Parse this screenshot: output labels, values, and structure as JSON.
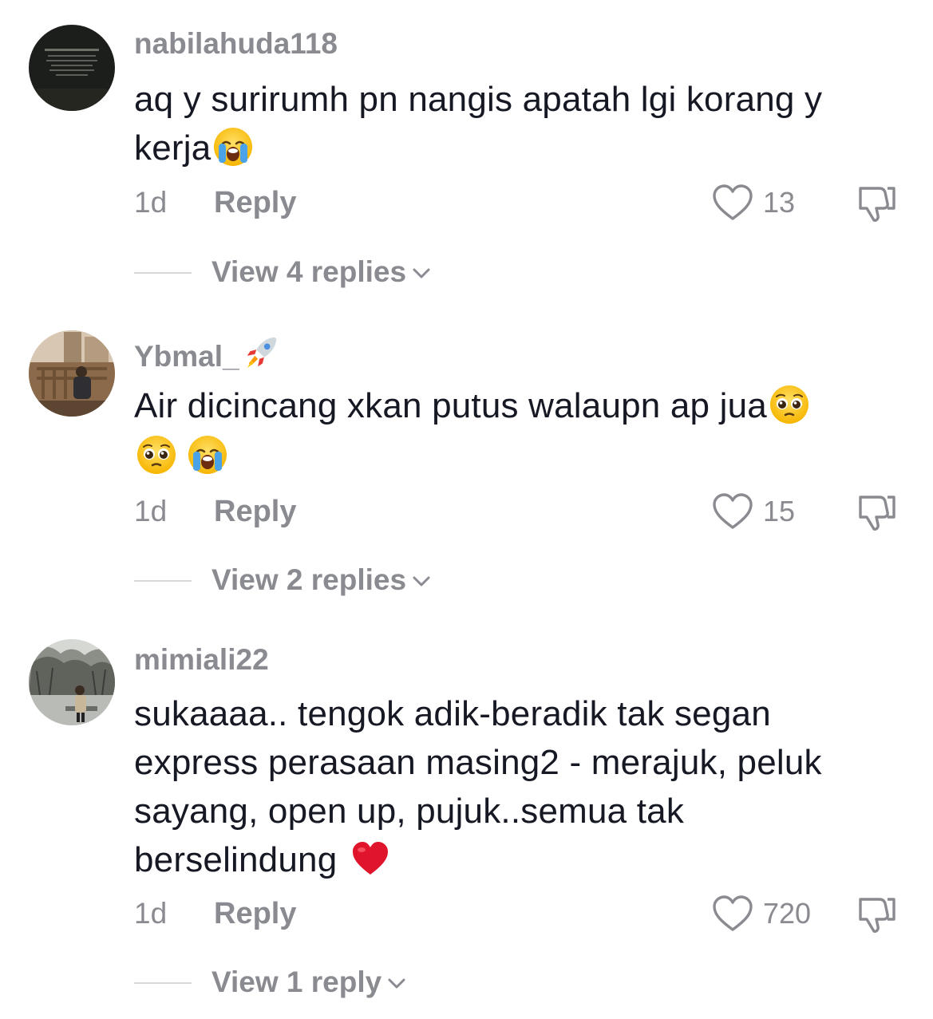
{
  "comments": [
    {
      "username": "nabilahuda118",
      "text_line1": "aq y surirumh pn nangis apatah lgi korang y",
      "text_line2": "kerja",
      "time": "1d",
      "reply_label": "Reply",
      "likes": "13",
      "view_replies": "View 4 replies",
      "avatar_icon": "dark-text-avatar",
      "emojis": [
        "loudly-crying-face"
      ]
    },
    {
      "username": "Ybmal_",
      "username_emoji": "rocket",
      "text_line1": "Air dicincang xkan putus walaupn ap jua",
      "time": "1d",
      "reply_label": "Reply",
      "likes": "15",
      "view_replies": "View 2 replies",
      "avatar_icon": "balcony-photo-avatar",
      "emojis": [
        "pleading-face",
        "pleading-face",
        "loudly-crying-face"
      ]
    },
    {
      "username": "mimiali22",
      "text_line1": "sukaaaa.. tengok adik-beradik tak segan",
      "text_line2": "express perasaan masing2 - merajuk, peluk",
      "text_line3": "sayang, open up, pujuk..semua tak",
      "text_line4": "berselindung",
      "time": "1d",
      "reply_label": "Reply",
      "likes": "720",
      "view_replies": "View 1 reply",
      "avatar_icon": "forest-photo-avatar",
      "emojis": [
        "red-heart"
      ]
    }
  ],
  "colors": {
    "primary_text": "#161823",
    "secondary_text": "#8a8b91",
    "divider": "#d8d8da",
    "background": "#ffffff"
  }
}
